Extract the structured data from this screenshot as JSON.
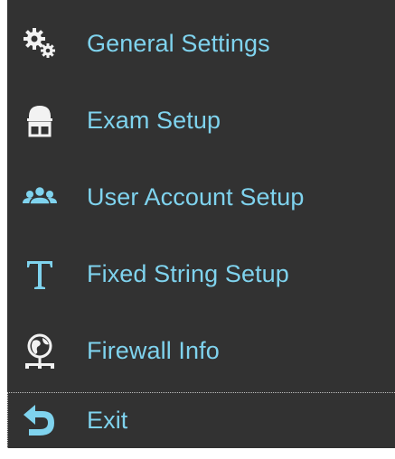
{
  "menu": {
    "accent_color": "#7fd3ee",
    "background_color": "#323232",
    "items": [
      {
        "label": "General Settings",
        "icon": "gears-icon"
      },
      {
        "label": "Exam Setup",
        "icon": "exam-user-icon"
      },
      {
        "label": "User Account Setup",
        "icon": "users-group-icon"
      },
      {
        "label": "Fixed String Setup",
        "icon": "text-t-icon"
      },
      {
        "label": "Firewall Info",
        "icon": "globe-network-icon"
      },
      {
        "label": "Exit",
        "icon": "undo-arrow-icon"
      }
    ],
    "focused_item": "Exit"
  }
}
